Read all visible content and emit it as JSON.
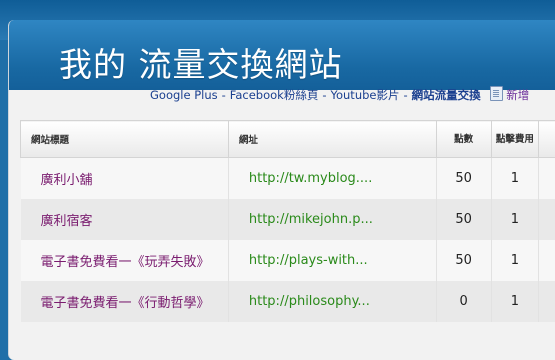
{
  "site": {
    "title": "我的 流量交換網站"
  },
  "nav": {
    "links": [
      "Google Plus",
      "Facebook粉絲頁",
      "Youtube影片",
      "網站流量交換"
    ],
    "separator": "-",
    "add_label": "新增"
  },
  "table": {
    "headers": [
      "網站標題",
      "網址",
      "點數",
      "點擊費用"
    ],
    "rows": [
      {
        "title": "廣利小舖",
        "url": "http://tw.myblog....",
        "points": "50",
        "cost": "1"
      },
      {
        "title": "廣利宿客",
        "url": "http://mikejohn.p...",
        "points": "50",
        "cost": "1"
      },
      {
        "title": "電子書免費看一《玩弄失敗》",
        "url": "http://plays-with...",
        "points": "50",
        "cost": "1"
      },
      {
        "title": "電子書免費看一《行動哲學》",
        "url": "http://philosophy...",
        "points": "0",
        "cost": "1"
      }
    ]
  }
}
